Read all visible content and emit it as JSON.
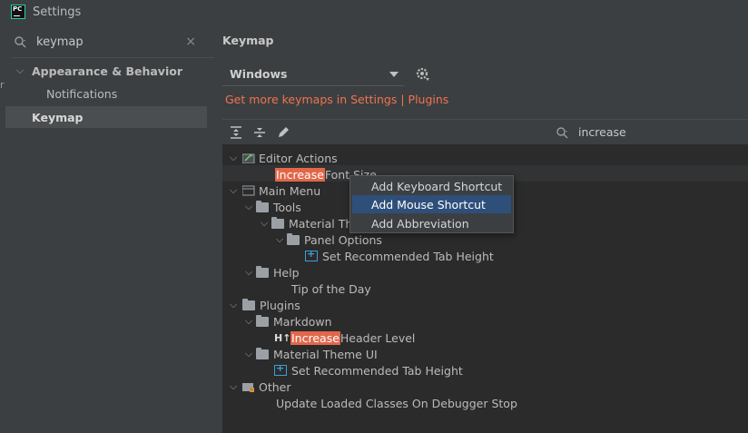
{
  "window": {
    "title": "Settings",
    "app_icon_text": "PC"
  },
  "sidebar": {
    "search_value": "keymap",
    "edge_glyph": "r",
    "items": [
      {
        "label": "Appearance & Behavior",
        "expanded": true
      },
      {
        "label": "Notifications"
      },
      {
        "label": "Keymap",
        "selected": true
      }
    ]
  },
  "main": {
    "title": "Keymap",
    "scheme_value": "Windows",
    "plugins_link": "Get more keymaps in Settings | Plugins",
    "filter_value": "increase",
    "tree": {
      "editor_actions": "Editor Actions",
      "increase_font_hl": "Increase",
      "increase_font_rest": " Font Size",
      "main_menu": "Main Menu",
      "tools": "Tools",
      "material_theme": "Material Th",
      "panel_options": "Panel Options",
      "set_tab_height_1": "Set Recommended Tab Height",
      "help": "Help",
      "tip_of_day": "Tip of the Day",
      "plugins": "Plugins",
      "markdown": "Markdown",
      "ht_icon": "H↑",
      "increase_header_hl": "Increase",
      "increase_header_rest": " Header Level",
      "material_theme_ui": "Material Theme UI",
      "set_tab_height_2": "Set Recommended Tab Height",
      "other": "Other",
      "update_classes": "Update Loaded Classes On Debugger Stop"
    }
  },
  "context_menu": {
    "items": [
      {
        "label": "Add Keyboard Shortcut"
      },
      {
        "label": "Add Mouse Shortcut",
        "active": true
      },
      {
        "label": "Add Abbreviation"
      }
    ]
  },
  "colors": {
    "accent_link": "#f0734f",
    "highlight": "#e2674a",
    "selection": "#2e4f7a"
  }
}
